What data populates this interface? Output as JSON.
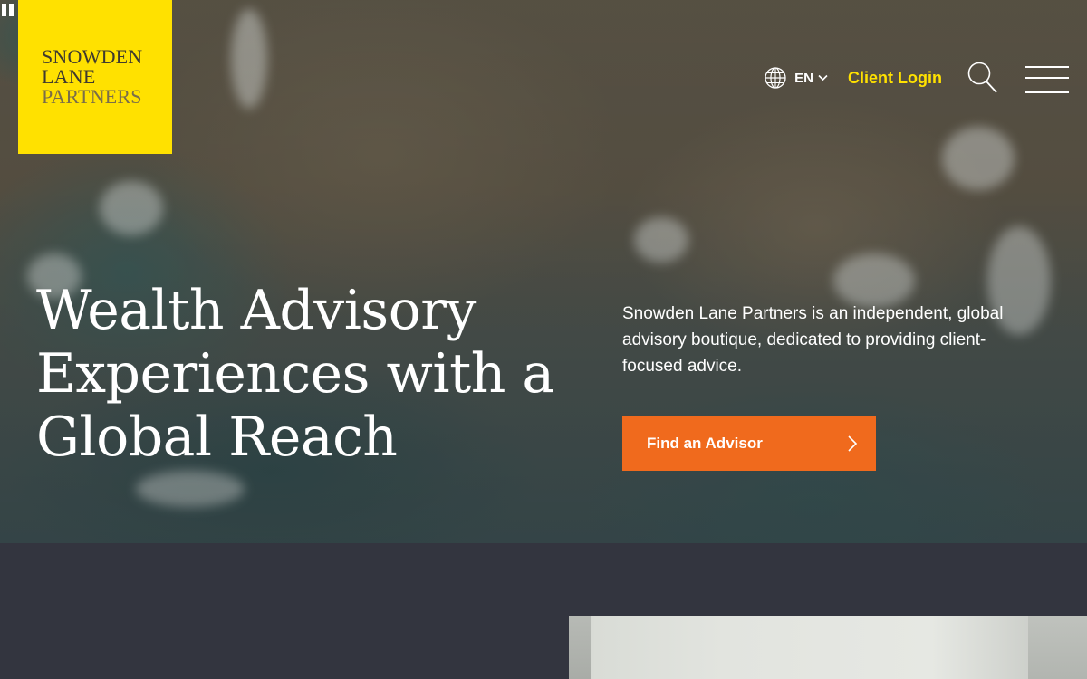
{
  "brand": {
    "logo_line1": "SNOWDEN",
    "logo_line2": "LANE",
    "logo_line3": "PARTNERS",
    "logo_color": "#ffe100"
  },
  "nav": {
    "language_icon": "globe-icon",
    "language": "EN",
    "language_chevron_icon": "chevron-down-icon",
    "client_login": "Client Login",
    "search_icon": "search-icon",
    "menu_icon": "hamburger-menu-icon"
  },
  "hero": {
    "headline_line1": "Wealth Advisory",
    "headline_line2": "Experiences with a",
    "headline_line3": "Global Reach",
    "tagline": "Snowden Lane Partners is an independent, global advisory boutique, dedicated to providing client-focused advice.",
    "cta_label": "Find an Advisor",
    "cta_icon": "chevron-right-icon",
    "cta_color": "#f06a1d"
  },
  "colors": {
    "accent_yellow": "#ffe100",
    "accent_orange": "#f06a1d",
    "section_background": "#33353f"
  }
}
